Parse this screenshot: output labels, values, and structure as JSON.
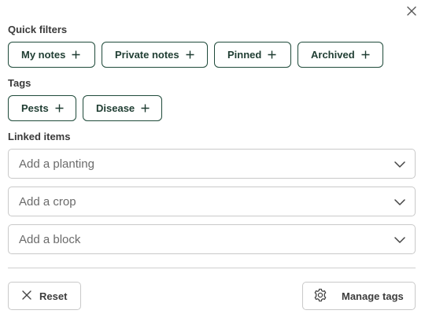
{
  "quick_filters": {
    "label": "Quick filters",
    "chips": [
      {
        "label": "My notes"
      },
      {
        "label": "Private notes"
      },
      {
        "label": "Pinned"
      },
      {
        "label": "Archived"
      }
    ]
  },
  "tags": {
    "label": "Tags",
    "chips": [
      {
        "label": "Pests"
      },
      {
        "label": "Disease"
      }
    ]
  },
  "linked_items": {
    "label": "Linked items",
    "selects": [
      {
        "placeholder": "Add a planting"
      },
      {
        "placeholder": "Add a crop"
      },
      {
        "placeholder": "Add a block"
      }
    ]
  },
  "footer": {
    "reset_label": "Reset",
    "manage_tags_label": "Manage tags"
  },
  "colors": {
    "chip_border": "#1f4a3a",
    "chip_text": "#1f3d32",
    "border": "#c9c9c9"
  },
  "icons": [
    "close-icon",
    "plus-icon",
    "chevron-down-icon",
    "x-icon",
    "gear-icon"
  ]
}
